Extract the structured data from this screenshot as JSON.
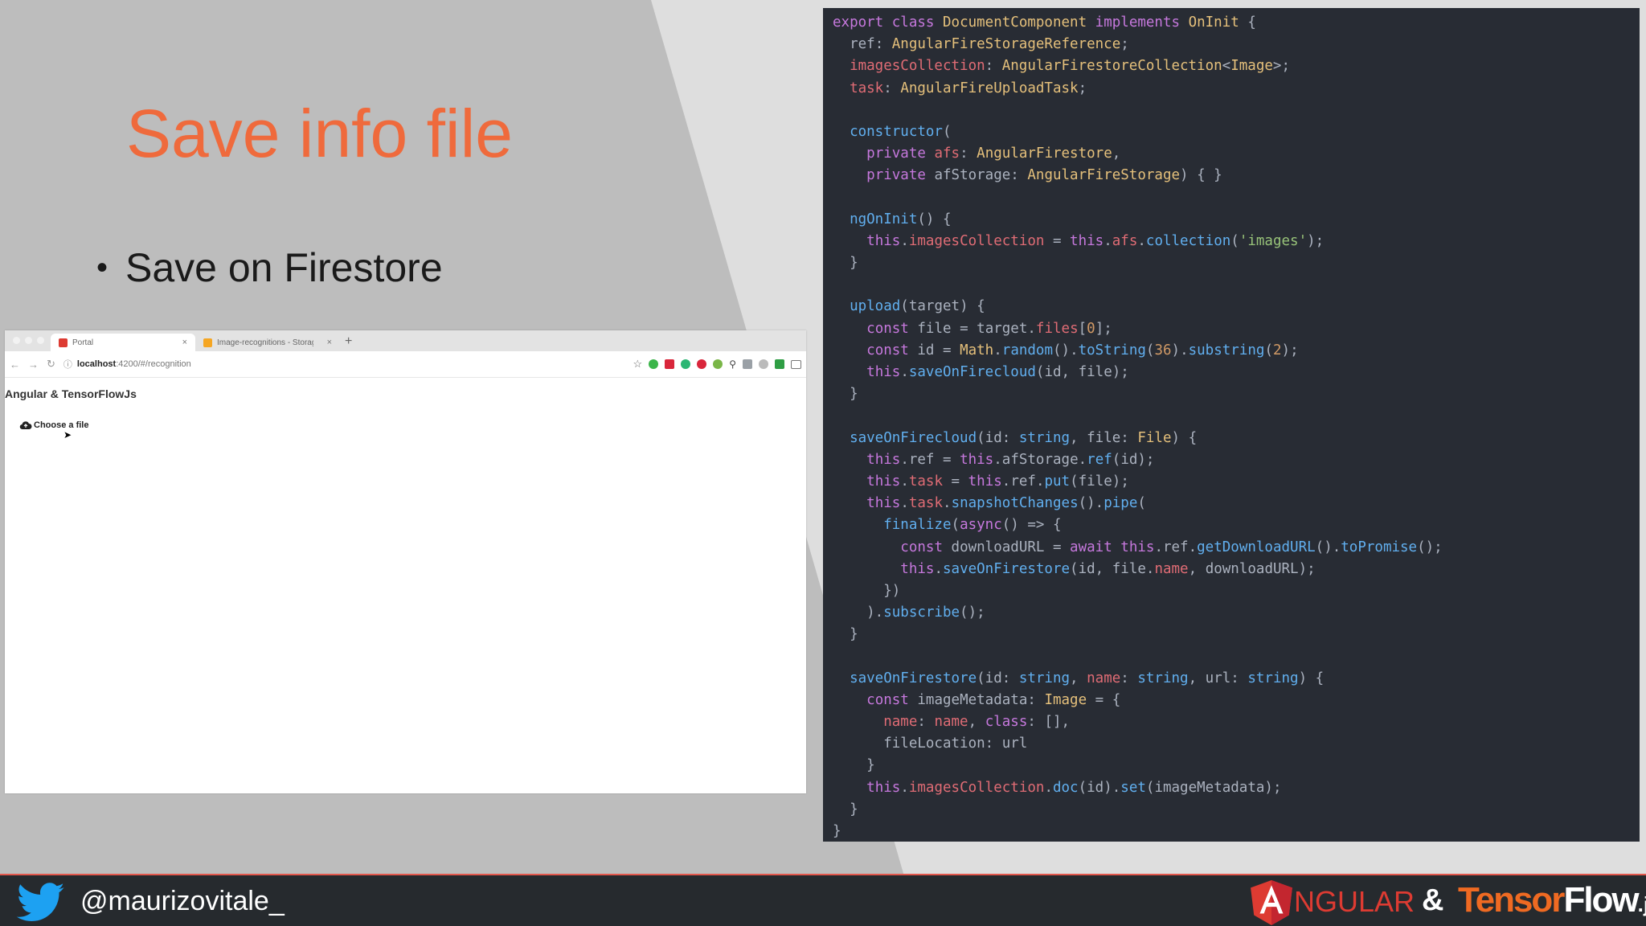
{
  "slide": {
    "title": "Save info file",
    "bullet": "Save on Firestore",
    "colors": {
      "title": "#ef6a3c",
      "accent_line": "#e2574c",
      "bar_bg": "#262a2e"
    }
  },
  "browser": {
    "tabs": [
      {
        "label": "Portal",
        "icon": "angular-favicon"
      },
      {
        "label": "Image-recognitions - Storage",
        "icon": "firebase-favicon"
      }
    ],
    "address": {
      "host": "localhost",
      "path": ":4200/#/recognition"
    },
    "app_title": "Angular & TensorFlowJs",
    "choose_label": "Choose a file"
  },
  "code": {
    "lines": [
      "export class DocumentComponent implements OnInit {",
      "  ref: AngularFireStorageReference;",
      "  imagesCollection: AngularFirestoreCollection<Image>;",
      "  task: AngularFireUploadTask;",
      "",
      "  constructor(",
      "    private afs: AngularFirestore,",
      "    private afStorage: AngularFireStorage) { }",
      "",
      "  ngOnInit() {",
      "    this.imagesCollection = this.afs.collection('images');",
      "  }",
      "",
      "  upload(target) {",
      "    const file = target.files[0];",
      "    const id = Math.random().toString(36).substring(2);",
      "    this.saveOnFirecloud(id, file);",
      "  }",
      "",
      "  saveOnFirecloud(id: string, file: File) {",
      "    this.ref = this.afStorage.ref(id);",
      "    this.task = this.ref.put(file);",
      "    this.task.snapshotChanges().pipe(",
      "      finalize(async() => {",
      "        const downloadURL = await this.ref.getDownloadURL().toPromise();",
      "        this.saveOnFirestore(id, file.name, downloadURL);",
      "      })",
      "    ).subscribe();",
      "  }",
      "",
      "  saveOnFirestore(id: string, name: string, url: string) {",
      "    const imageMetadata: Image = {",
      "      name: name, class: [],",
      "      fileLocation: url",
      "    }",
      "    this.imagesCollection.doc(id).set(imageMetadata);",
      "  }",
      "}"
    ]
  },
  "footer": {
    "handle": "@maurizovitale_",
    "angular_text": "NGULAR",
    "amp": "&",
    "tf_tensor": "Tensor",
    "tf_flow": "Flow",
    "tf_js": ".js"
  }
}
